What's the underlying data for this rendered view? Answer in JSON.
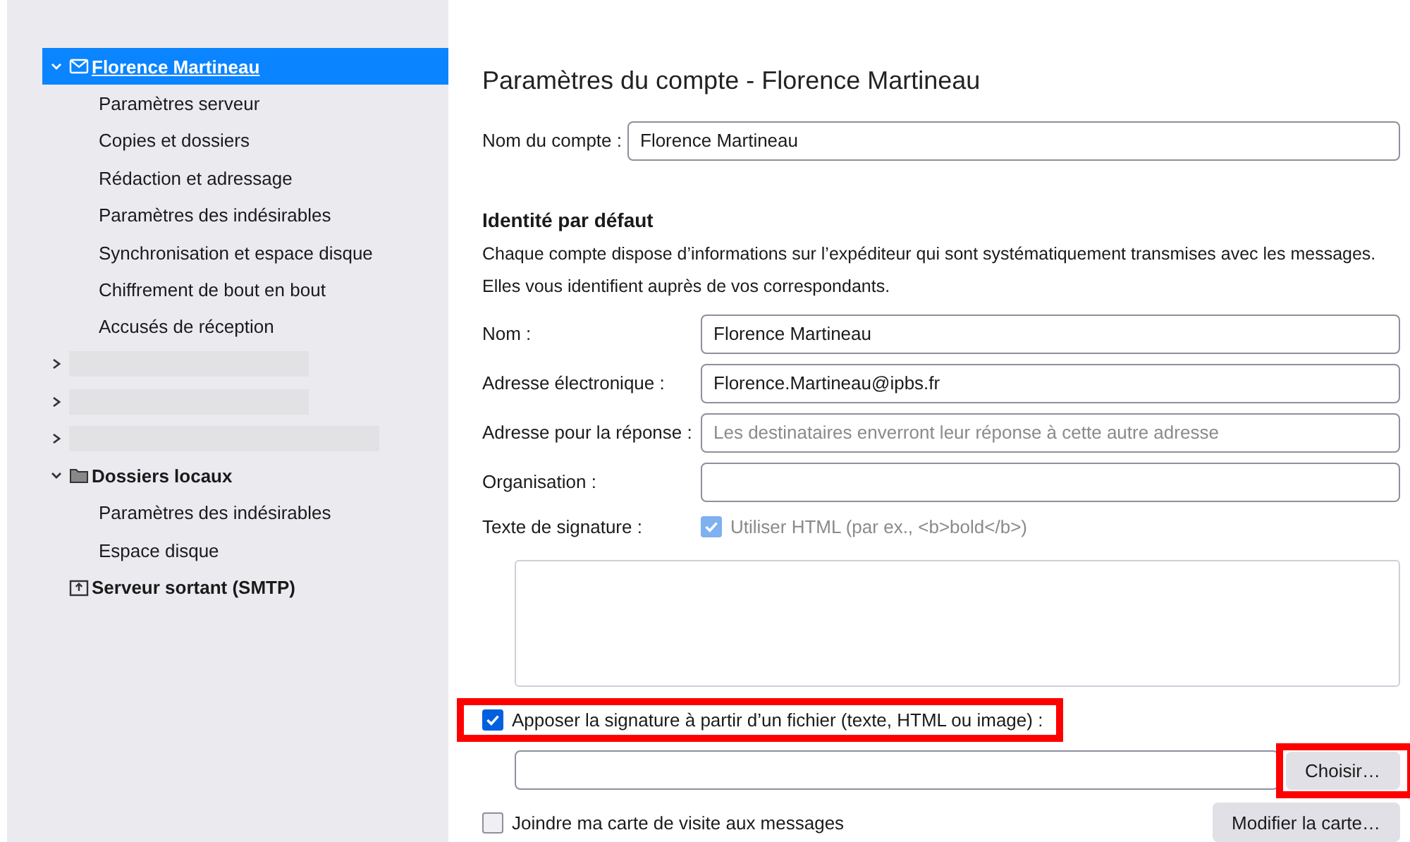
{
  "sidebar": {
    "items": [
      {
        "kind": "mail_account",
        "label": "Florence Martineau",
        "selected": true,
        "expanded": true,
        "children": [
          {
            "label": "Paramètres serveur",
            "selected": false
          },
          {
            "label": "Copies et dossiers",
            "selected": false
          },
          {
            "label": "Rédaction et adressage",
            "selected": false
          },
          {
            "label": "Paramètres des indésirables",
            "selected": false
          },
          {
            "label": "Synchronisation et espace disque",
            "selected": false
          },
          {
            "label": "Chiffrement de bout en bout",
            "selected": false
          },
          {
            "label": "Accusés de réception",
            "selected": false
          }
        ]
      },
      {
        "kind": "redacted",
        "expanded": false
      },
      {
        "kind": "redacted",
        "expanded": false
      },
      {
        "kind": "redacted",
        "expanded": false
      },
      {
        "kind": "local_folders",
        "label": "Dossiers locaux",
        "selected": false,
        "expanded": true,
        "children": [
          {
            "label": "Paramètres des indésirables",
            "selected": false
          },
          {
            "label": "Espace disque",
            "selected": false
          }
        ]
      },
      {
        "kind": "outgoing_server",
        "label": "Serveur sortant (SMTP)",
        "selected": false
      }
    ]
  },
  "main": {
    "title": "Paramètres du compte - Florence Martineau",
    "account_name": {
      "label": "Nom du compte :",
      "value": "Florence Martineau"
    },
    "identity": {
      "heading": "Identité par défaut",
      "description": [
        "Chaque compte dispose d’informations sur l’expéditeur qui sont systématiquement transmises avec les messages.",
        "Elles vous identifient auprès de vos correspondants."
      ],
      "fields": [
        {
          "label": "Nom :",
          "value": "Florence Martineau"
        },
        {
          "label": "Adresse électronique :",
          "value": "Florence.Martineau@ipbs.fr"
        },
        {
          "label": "Adresse pour la réponse :",
          "placeholder": "Les destinataires enverront leur réponse à cette autre adresse"
        },
        {
          "label": "Organisation :"
        }
      ],
      "signature": {
        "label": "Texte de signature :",
        "use_html": {
          "label": "Utiliser HTML (par ex., <b>bold</b>)",
          "checked": true,
          "disabled": true
        }
      },
      "signature_file": {
        "label": "Apposer la signature à partir d’un fichier (texte, HTML ou image) :",
        "checked": true,
        "highlighted": true
      },
      "choose_button": {
        "label": "Choisir…",
        "highlighted": true
      },
      "vcard": {
        "label": "Joindre ma carte de visite aux messages",
        "checked": false
      },
      "edit_card_button": {
        "label": "Modifier la carte…"
      }
    }
  }
}
